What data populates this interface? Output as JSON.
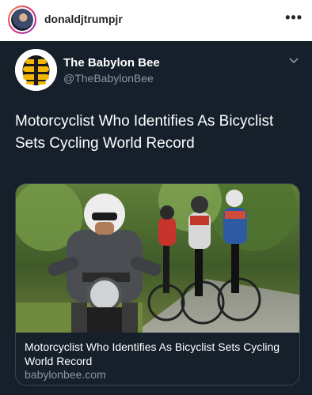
{
  "instagram_post": {
    "username": "donaldjtrumpjr",
    "more_icon": "more-horizontal-icon"
  },
  "tweet": {
    "account_name": "The Babylon Bee",
    "handle": "@TheBabylonBee",
    "text": "Motorcyclist Who Identifies As Bicyclist Sets Cycling World Record",
    "menu_icon": "chevron-down-icon",
    "logo_icon": "babylon-bee-logo-icon",
    "card": {
      "image_description_icon": "motorcyclist-with-cyclists-photo",
      "title": "Motorcyclist Who Identifies As Bicyclist Sets Cycling World Record",
      "domain": "babylonbee.com"
    }
  },
  "colors": {
    "tweet_background": "#15202b",
    "secondary_text": "#8899a6",
    "card_border": "#38444d",
    "bee_yellow": "#f2b705"
  }
}
